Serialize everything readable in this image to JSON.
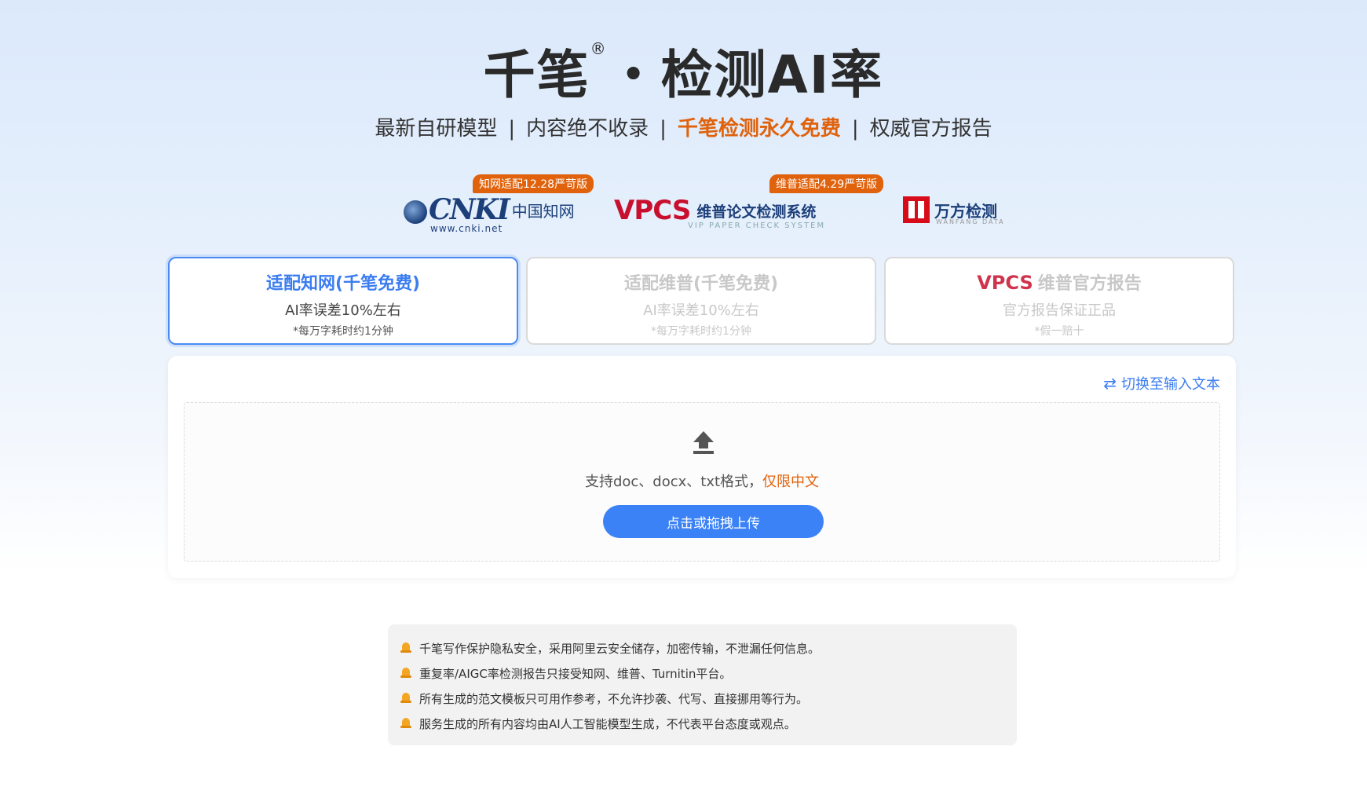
{
  "header": {
    "title_main": "千笔",
    "registered_mark": "®",
    "title_rest": "・检测AI率",
    "subtitle": {
      "item1": "最新自研模型",
      "item2": "内容绝不收录",
      "item3": "千笔检测永久免费",
      "item4": "权威官方报告",
      "separator": "|"
    }
  },
  "logos": {
    "cnki": {
      "badge": "知网适配12.28严苛版",
      "mark": "CNKI",
      "zh": "中国知网",
      "url": "www.cnki.net"
    },
    "vpcs": {
      "badge": "维普适配4.29严苛版",
      "mark": "VPCS",
      "cn": "维普论文检测系统",
      "en": "VIP PAPER CHECK SYSTEM"
    },
    "wanfang": {
      "cn": "万方检测",
      "en": "WANFANG DATA"
    }
  },
  "tabs": [
    {
      "title": "适配知网(千笔免费)",
      "desc": "AI率误差10%左右",
      "note": "*每万字耗时约1分钟",
      "active": true
    },
    {
      "title": "适配维普(千笔免费)",
      "desc": "AI率误差10%左右",
      "note": "*每万字耗时约1分钟",
      "active": false
    },
    {
      "logo": "VPCS",
      "title": "维普官方报告",
      "desc": "官方报告保证正品",
      "note": "*假一赔十",
      "active": false
    }
  ],
  "upload": {
    "switch_icon": "swap-icon",
    "switch_label": "切换至输入文本",
    "formats_text": "支持doc、docx、txt格式，",
    "chinese_only": "仅限中文",
    "button_label": "点击或拖拽上传"
  },
  "notices": [
    "千笔写作保护隐私安全，采用阿里云安全储存，加密传输，不泄漏任何信息。",
    "重复率/AIGC率检测报告只接受知网、维普、Turnitin平台。",
    "所有生成的范文模板只可用作参考，不允许抄袭、代写、直接挪用等行为。",
    "服务生成的所有内容均由AI人工智能模型生成，不代表平台态度或观点。"
  ],
  "colors": {
    "accent_blue": "#3b82f6",
    "highlight_orange": "#e0620c",
    "brand_red": "#c8102e"
  }
}
